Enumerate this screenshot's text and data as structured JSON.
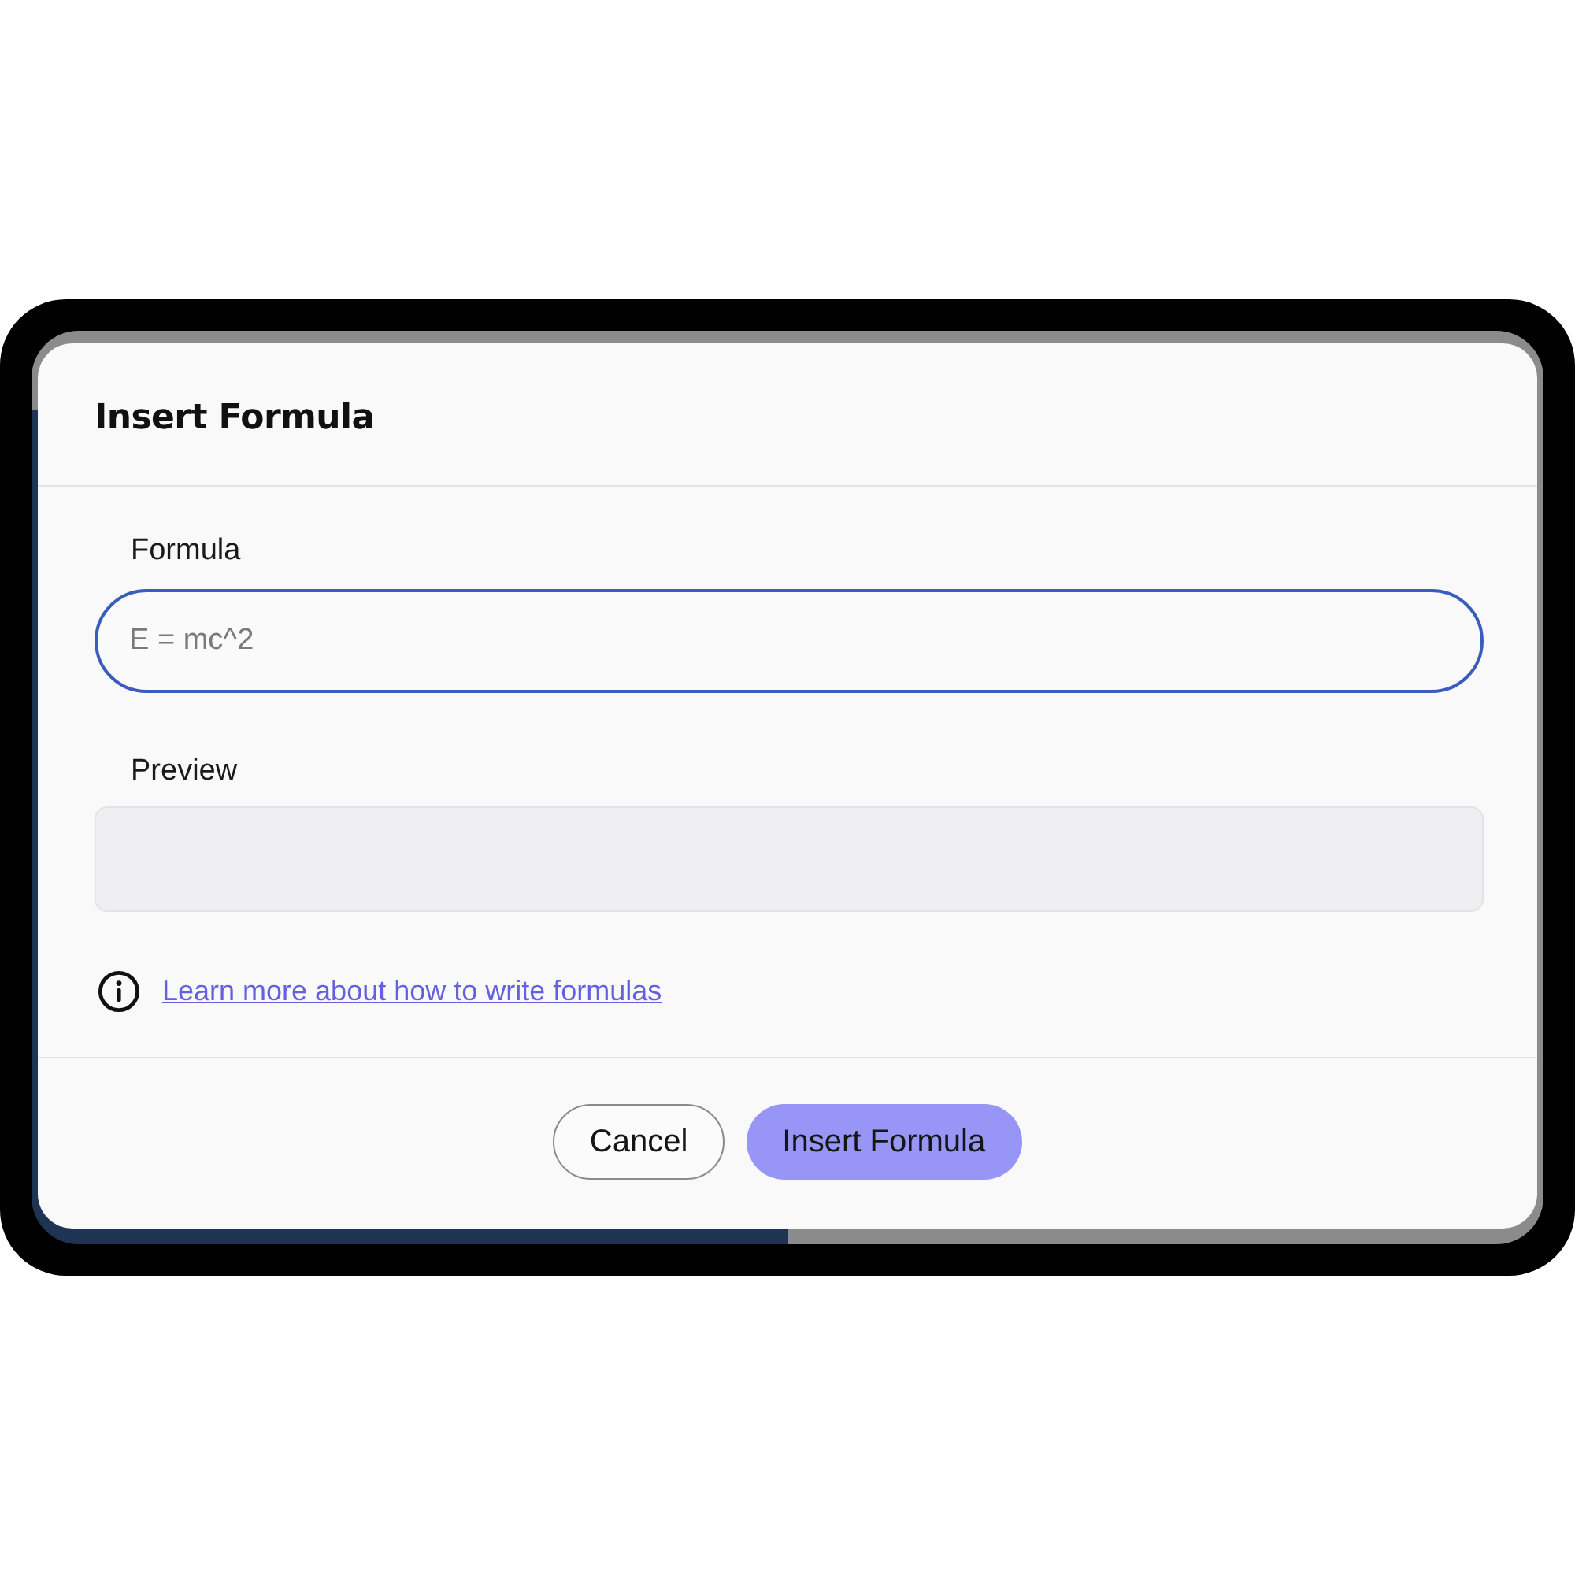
{
  "dialog": {
    "title": "Insert Formula"
  },
  "formula": {
    "label": "Formula",
    "placeholder": "E = mc^2",
    "focused": true
  },
  "preview": {
    "label": "Preview"
  },
  "help_link": {
    "text": "Learn more about how to write formulas"
  },
  "buttons": [
    {
      "label": "Cancel",
      "kind": "secondary"
    },
    {
      "label": "Insert Formula",
      "kind": "primary"
    }
  ]
}
